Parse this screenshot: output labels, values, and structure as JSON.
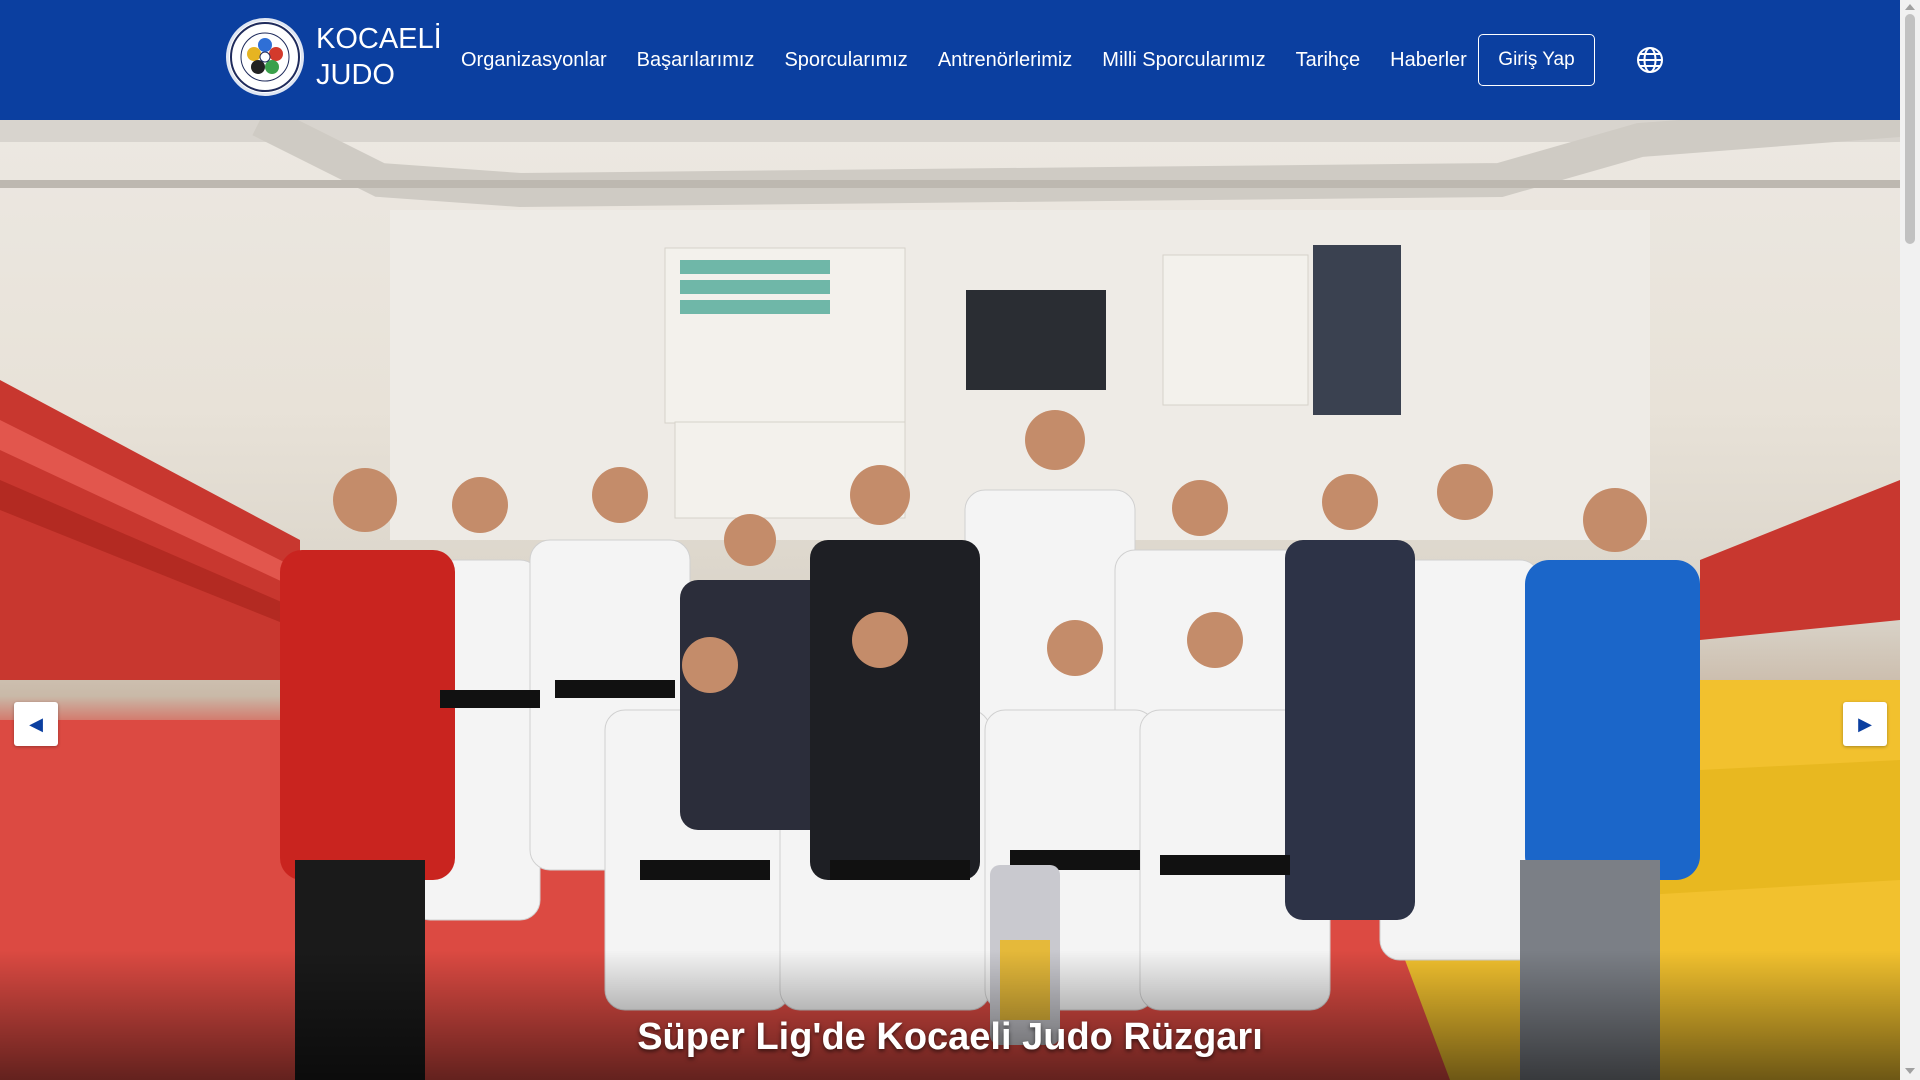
{
  "brand": {
    "line1": "KOCAELİ",
    "line2": "JUDO",
    "logo_icon": "ijf-logo-icon"
  },
  "nav": {
    "items": [
      {
        "label": "Organizasyonlar"
      },
      {
        "label": "Başarılarımız"
      },
      {
        "label": "Sporcularımız"
      },
      {
        "label": "Antrenörlerimiz"
      },
      {
        "label": "Milli Sporcularımız"
      },
      {
        "label": "Tarihçe"
      },
      {
        "label": "Haberler"
      }
    ],
    "login_label": "Giriş Yap",
    "language_icon": "globe-icon"
  },
  "hero": {
    "caption": "Süper Lig'de Kocaeli Judo Rüzgarı",
    "prev_icon": "caret-left-icon",
    "next_icon": "caret-right-icon"
  },
  "colors": {
    "navbar": "#0b3fa0",
    "text": "#ffffff",
    "mat_red": "#dc4a42",
    "mat_yellow": "#f2c12e"
  }
}
